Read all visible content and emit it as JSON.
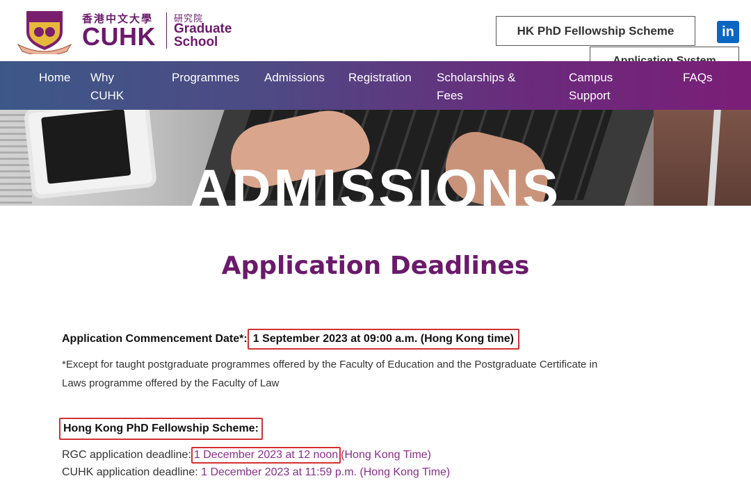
{
  "header": {
    "logo_chinese": "香港中文大學",
    "logo_abbr": "CUHK",
    "school_chinese": "研究院",
    "school_name_line1": "Graduate",
    "school_name_line2": "School",
    "buttons": {
      "phd": "HK PhD Fellowship Scheme",
      "application": "Application System"
    },
    "social": "in"
  },
  "nav": {
    "items": [
      {
        "label_line1": "Home",
        "label_line2": ""
      },
      {
        "label_line1": "Why",
        "label_line2": "CUHK"
      },
      {
        "label_line1": "Programmes",
        "label_line2": ""
      },
      {
        "label_line1": "Admissions",
        "label_line2": ""
      },
      {
        "label_line1": "Registration",
        "label_line2": ""
      },
      {
        "label_line1": "Scholarships &",
        "label_line2": "Fees"
      },
      {
        "label_line1": "Campus",
        "label_line2": "Support"
      },
      {
        "label_line1": "FAQs",
        "label_line2": ""
      }
    ]
  },
  "hero": {
    "title": "ADMISSIONS"
  },
  "content": {
    "title": "Application Deadlines",
    "commencement_label": "Application Commencement Date*:",
    "commencement_value": "1 September 2023 at 09:00 a.m. (Hong Kong time)",
    "footnote_line1": "*Except for taught postgraduate programmes offered by the Faculty of Education and the Postgraduate Certificate in",
    "footnote_line2": "Laws programme offered by the Faculty of Law",
    "hkpfs_heading": "Hong Kong PhD Fellowship Scheme:",
    "rgc_label": "RGC application deadline:",
    "rgc_value": "1 December 2023 at 12 noon",
    "rgc_suffix": "(Hong Kong Time)",
    "cuhk_label": "CUHK application deadline:",
    "cuhk_value": "1 December 2023 at 11:59 p.m. (Hong Kong Time)"
  },
  "colors": {
    "brand_purple": "#6b1a6b",
    "nav_gradient_start": "#3d5888",
    "nav_gradient_end": "#7b1e78",
    "highlight_box": "#d23030",
    "link_purple": "#8a2e8a"
  }
}
